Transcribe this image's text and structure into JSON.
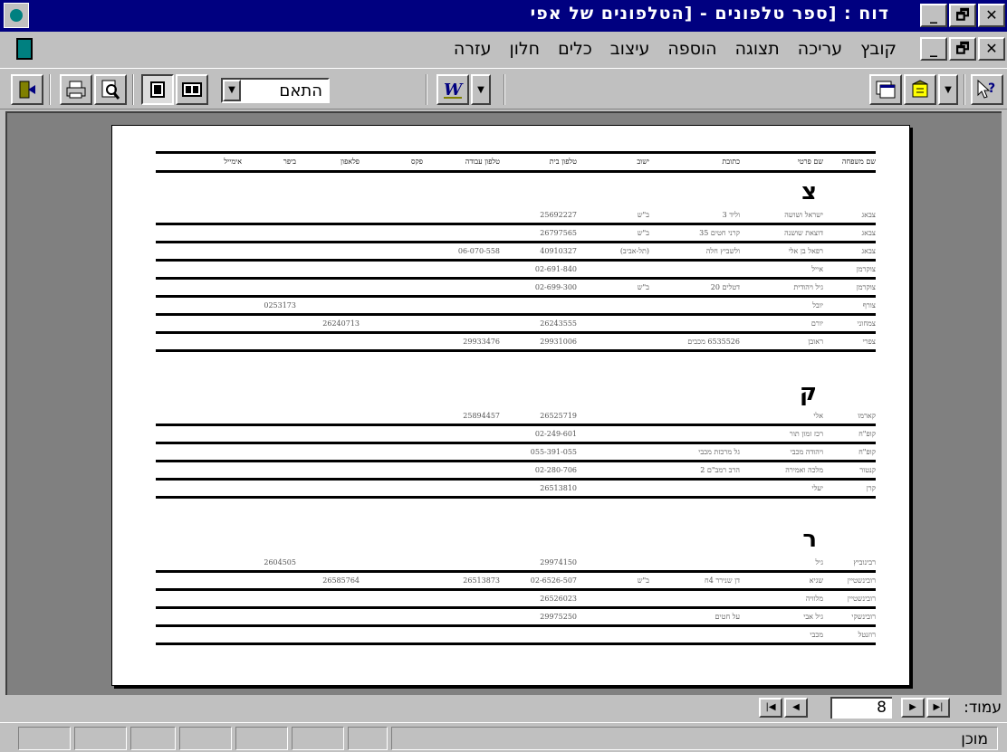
{
  "window": {
    "title": "דוח : [ספר טלפונים - [הטלפונים של אפי",
    "controls": [
      "_",
      "🗗",
      "✕"
    ]
  },
  "menu": {
    "items": [
      "קובץ",
      "עריכה",
      "תצוגה",
      "הוספה",
      "עיצוב",
      "כלים",
      "חלון",
      "עזרה"
    ],
    "controls": [
      "_",
      "🗗",
      "✕"
    ]
  },
  "toolbar": {
    "zoom_value": "התאם"
  },
  "report": {
    "columns": [
      "שם משפחה",
      "שם פרטי",
      "כתובת",
      "ישוב",
      "טלפון בית",
      "טלפון עבודה",
      "פקס",
      "פלאפון",
      "ביפר",
      "אימייל"
    ],
    "sections": [
      {
        "letter": "צ",
        "rows": [
          {
            "last": "צבאג",
            "first": "ישראל ושושה",
            "address": "וליד 3",
            "city": "ב\"ש",
            "home": "25692227",
            "work": "",
            "fax": "",
            "mobile": "",
            "pager": ""
          },
          {
            "last": "צבאג",
            "first": "דוצאת שושנה",
            "address": "קרני חטים 35",
            "city": "ב\"ש",
            "home": "26797565",
            "work": "",
            "fax": "",
            "mobile": "",
            "pager": ""
          },
          {
            "last": "צבאג",
            "first": "רפאל בן אלי",
            "address": "ולשביץ חלה",
            "city": "(תל-אביב)",
            "home": "40910327",
            "work": "06-070-558",
            "fax": "",
            "mobile": "",
            "pager": ""
          },
          {
            "last": "צוקרמן",
            "first": "אייל",
            "address": "",
            "city": "",
            "home": "02-691-840",
            "work": "",
            "fax": "",
            "mobile": "",
            "pager": ""
          },
          {
            "last": "צוקרמן",
            "first": "גיל ויהודית",
            "address": "דטלים 20",
            "city": "ב\"ש",
            "home": "02-699-300",
            "work": "",
            "fax": "",
            "mobile": "",
            "pager": ""
          },
          {
            "last": "צורף",
            "first": "יובל",
            "address": "",
            "city": "",
            "home": "",
            "work": "",
            "fax": "",
            "mobile": "",
            "pager": "0253173"
          },
          {
            "last": "צמחוני",
            "first": "יורם",
            "address": "",
            "city": "",
            "home": "26243555",
            "work": "",
            "fax": "",
            "mobile": "26240713",
            "pager": ""
          },
          {
            "last": "צפרי",
            "first": "ראובן",
            "address": "6535526 מכבים",
            "city": "",
            "home": "29931006",
            "work": "29933476",
            "fax": "",
            "mobile": "",
            "pager": ""
          }
        ]
      },
      {
        "letter": "ק",
        "rows": [
          {
            "last": "קארמו",
            "first": "אלי",
            "address": "",
            "city": "",
            "home": "26525719",
            "work": "25894457",
            "fax": "",
            "mobile": "",
            "pager": ""
          },
          {
            "last": "קופ\"ח",
            "first": "רכז זמון תור",
            "address": "",
            "city": "",
            "home": "02-249-601",
            "work": "",
            "fax": "",
            "mobile": "",
            "pager": ""
          },
          {
            "last": "קופ\"ח",
            "first": "ויהודה מכבי",
            "address": "גל מרכזת מכבי",
            "city": "",
            "home": "055-391-055",
            "work": "",
            "fax": "",
            "mobile": "",
            "pager": ""
          },
          {
            "last": "קנטור",
            "first": "מלכה ואמירה",
            "address": "הרב רמב\"ם 2",
            "city": "",
            "home": "02-280-706",
            "work": "",
            "fax": "",
            "mobile": "",
            "pager": ""
          },
          {
            "last": "קרן",
            "first": "יעלי",
            "address": "",
            "city": "",
            "home": "26513810",
            "work": "",
            "fax": "",
            "mobile": "",
            "pager": ""
          }
        ]
      },
      {
        "letter": "ר",
        "rows": [
          {
            "last": "רבינוביץ",
            "first": "גיל",
            "address": "",
            "city": "",
            "home": "29974150",
            "work": "",
            "fax": "",
            "mobile": "",
            "pager": "2604505"
          },
          {
            "last": "רובינשטיין",
            "first": "שגיא",
            "address": "דן שנירר 4ח",
            "city": "ב\"ש",
            "home": "02-6526-507",
            "work": "26513873",
            "fax": "",
            "mobile": "26585764",
            "pager": ""
          },
          {
            "last": "רובינשטיין",
            "first": "מלוויה",
            "address": "",
            "city": "",
            "home": "26526023",
            "work": "",
            "fax": "",
            "mobile": "",
            "pager": ""
          },
          {
            "last": "רובינשקי",
            "first": "גיל אבי",
            "address": "על חטים",
            "city": "",
            "home": "29975250",
            "work": "",
            "fax": "",
            "mobile": "",
            "pager": ""
          },
          {
            "last": "רוזנטל",
            "first": "מכבי",
            "address": "",
            "city": "",
            "home": "",
            "work": "",
            "fax": "",
            "mobile": "",
            "pager": ""
          }
        ]
      }
    ]
  },
  "navigation": {
    "page_label": "עמוד:",
    "page_number": "8"
  },
  "status": {
    "text": "מוכן"
  }
}
